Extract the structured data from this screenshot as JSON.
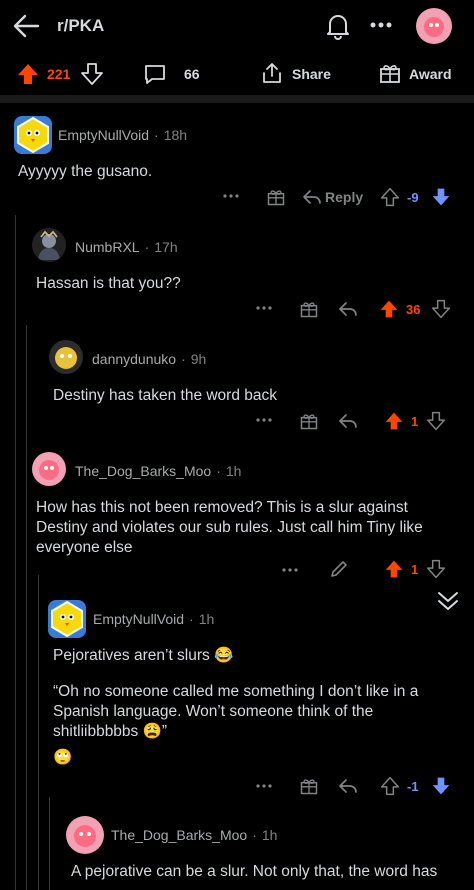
{
  "header": {
    "subreddit": "r/PKA"
  },
  "post_actions": {
    "score": "221",
    "comments": "66",
    "share": "Share",
    "award": "Award"
  },
  "comments": [
    {
      "author": "EmptyNullVoid",
      "time": "18h",
      "body": "Ayyyyy the gusano.",
      "reply": "Reply",
      "score": "-9"
    },
    {
      "author": "NumbRXL",
      "time": "17h",
      "body": "Hassan is that you??",
      "score": "36"
    },
    {
      "author": "dannydunuko",
      "time": "9h",
      "body": "Destiny has taken the word back",
      "score": "1"
    },
    {
      "author": "The_Dog_Barks_Moo",
      "time": "1h",
      "body": "How has this not been removed? This is a slur against Destiny and violates our sub rules. Just call him Tiny like everyone else",
      "score": "1"
    },
    {
      "author": "EmptyNullVoid",
      "time": "1h",
      "body_1": "Pejoratives aren’t slurs 😂",
      "body_2": "“Oh no someone called me something I don’t like in a Spanish language. Won’t someone think of the shitliibbbbbs 😩”",
      "body_3": "🙄",
      "score": "-1"
    },
    {
      "author": "The_Dog_Barks_Moo",
      "time": "1h",
      "body": "A pejorative can be a slur. Not only that, the word has"
    }
  ],
  "colors": {
    "upvote": "#ff4500",
    "downvote": "#7193ff",
    "background": "#000000"
  },
  "icons": [
    "back-arrow-icon",
    "bell-icon",
    "more-icon",
    "avatar",
    "upvote-icon",
    "downvote-icon",
    "comment-icon",
    "share-icon",
    "award-icon",
    "reply-icon",
    "edit-icon",
    "collapse-icon"
  ]
}
